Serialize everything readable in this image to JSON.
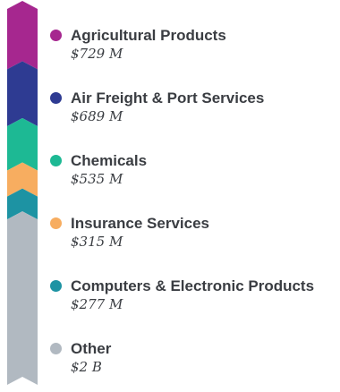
{
  "chart_data": {
    "type": "bar",
    "stacked": true,
    "orientation": "vertical",
    "legend_position": "right",
    "grid": false,
    "series": [
      {
        "name": "Agricultural Products",
        "value": 729,
        "label": "$729 M",
        "color": "#a6278f"
      },
      {
        "name": "Air Freight & Port Services",
        "value": 689,
        "label": "$689 M",
        "color": "#2e3b92"
      },
      {
        "name": "Chemicals",
        "value": 535,
        "label": "$535 M",
        "color": "#1db994"
      },
      {
        "name": "Insurance Services",
        "value": 315,
        "label": "$315 M",
        "color": "#f7ad60"
      },
      {
        "name": "Computers & Electronic Products",
        "value": 277,
        "label": "$277 M",
        "color": "#1d93a3"
      },
      {
        "name": "Other",
        "value": 2000,
        "label": "$2 B",
        "color": "#b1b9c1"
      }
    ]
  }
}
